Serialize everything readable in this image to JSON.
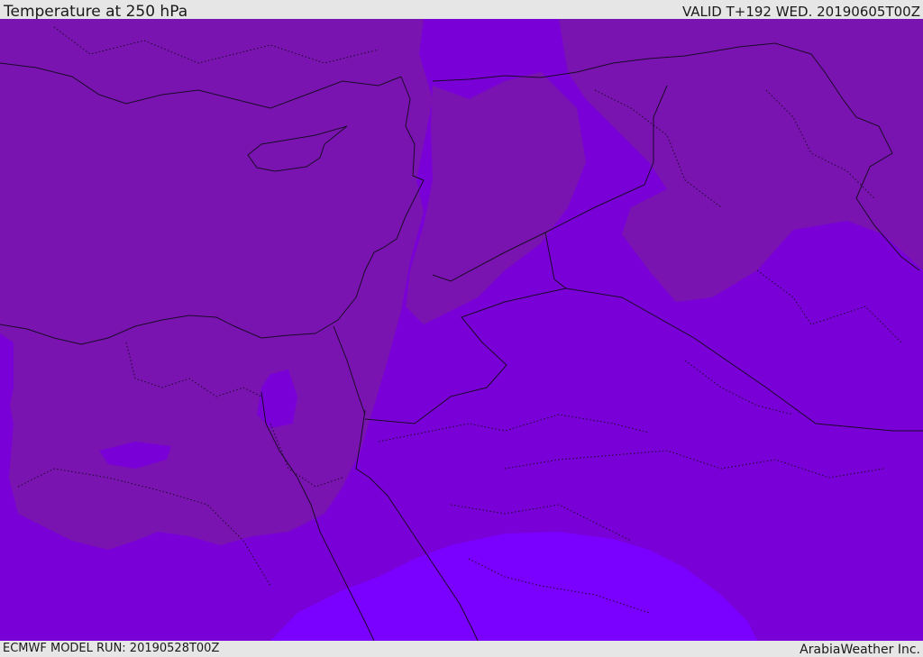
{
  "header": {
    "title": "Temperature at 250 hPa",
    "valid": "VALID T+192 WED. 20190605T00Z"
  },
  "footer": {
    "model_run": "ECMWF MODEL RUN: 20190528T00Z",
    "credit": "ArabiaWeather Inc."
  },
  "colors": {
    "band_cold": "#7a14b0",
    "band_mid": "#7a00d8",
    "band_warm": "#7a00ff",
    "boundaries": "#1a0a28"
  }
}
